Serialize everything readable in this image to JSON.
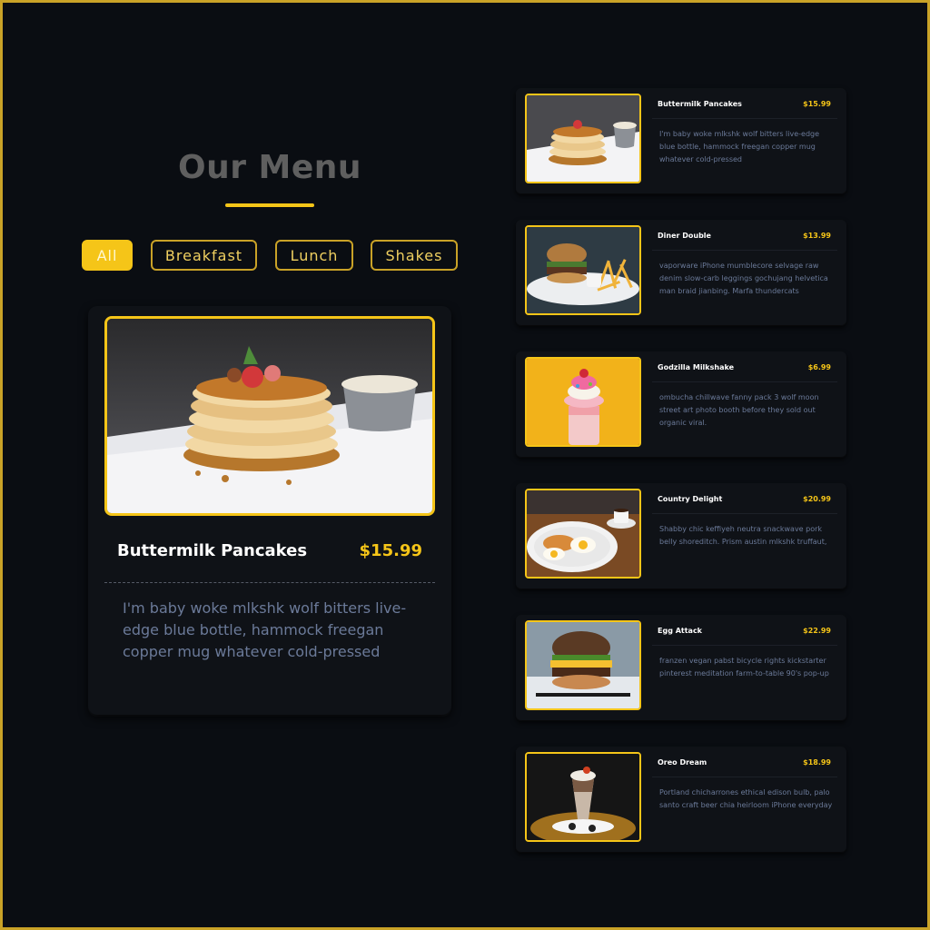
{
  "heading": "Our Menu",
  "filters": [
    {
      "label": "All",
      "active": true
    },
    {
      "label": "Breakfast",
      "active": false
    },
    {
      "label": "Lunch",
      "active": false
    },
    {
      "label": "Shakes",
      "active": false
    }
  ],
  "featured": {
    "title": "Buttermilk Pancakes",
    "price": "$15.99",
    "description": "I'm baby woke mlkshk wolf bitters live-edge blue bottle, hammock freegan copper mug whatever cold-pressed"
  },
  "items": [
    {
      "title": "Buttermilk Pancakes",
      "price": "$15.99",
      "description": "I'm baby woke mlkshk wolf bitters live-edge blue bottle, hammock freegan copper mug whatever cold-pressed"
    },
    {
      "title": "Diner Double",
      "price": "$13.99",
      "description": "vaporware iPhone mumblecore selvage raw denim slow-carb leggings gochujang helvetica man braid jianbing. Marfa thundercats"
    },
    {
      "title": "Godzilla Milkshake",
      "price": "$6.99",
      "description": "ombucha chillwave fanny pack 3 wolf moon street art photo booth before they sold out organic viral."
    },
    {
      "title": "Country Delight",
      "price": "$20.99",
      "description": "Shabby chic keffiyeh neutra snackwave pork belly shoreditch. Prism austin mlkshk truffaut,"
    },
    {
      "title": "Egg Attack",
      "price": "$22.99",
      "description": "franzen vegan pabst bicycle rights kickstarter pinterest meditation farm-to-table 90's pop-up"
    },
    {
      "title": "Oreo Dream",
      "price": "$18.99",
      "description": "Portland chicharrones ethical edison bulb, palo santo craft beer chia heirloom iPhone everyday"
    }
  ],
  "colors": {
    "background": "#0a0d12",
    "accent": "#f5c518",
    "border": "#c9a227",
    "description_text": "#6b7a99"
  }
}
